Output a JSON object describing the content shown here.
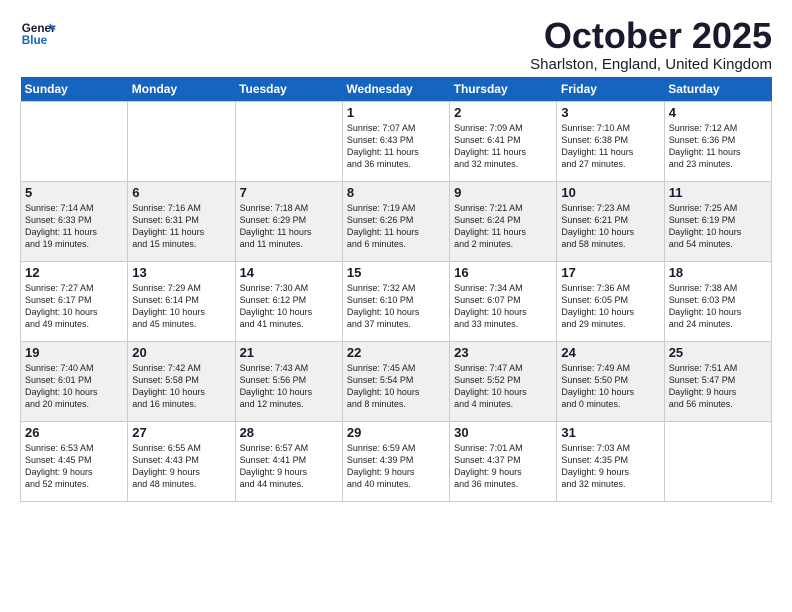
{
  "header": {
    "logo_line1": "General",
    "logo_line2": "Blue",
    "title": "October 2025",
    "subtitle": "Sharlston, England, United Kingdom"
  },
  "days": [
    "Sunday",
    "Monday",
    "Tuesday",
    "Wednesday",
    "Thursday",
    "Friday",
    "Saturday"
  ],
  "weeks": [
    [
      {
        "num": "",
        "text": ""
      },
      {
        "num": "",
        "text": ""
      },
      {
        "num": "",
        "text": ""
      },
      {
        "num": "1",
        "text": "Sunrise: 7:07 AM\nSunset: 6:43 PM\nDaylight: 11 hours\nand 36 minutes."
      },
      {
        "num": "2",
        "text": "Sunrise: 7:09 AM\nSunset: 6:41 PM\nDaylight: 11 hours\nand 32 minutes."
      },
      {
        "num": "3",
        "text": "Sunrise: 7:10 AM\nSunset: 6:38 PM\nDaylight: 11 hours\nand 27 minutes."
      },
      {
        "num": "4",
        "text": "Sunrise: 7:12 AM\nSunset: 6:36 PM\nDaylight: 11 hours\nand 23 minutes."
      }
    ],
    [
      {
        "num": "5",
        "text": "Sunrise: 7:14 AM\nSunset: 6:33 PM\nDaylight: 11 hours\nand 19 minutes."
      },
      {
        "num": "6",
        "text": "Sunrise: 7:16 AM\nSunset: 6:31 PM\nDaylight: 11 hours\nand 15 minutes."
      },
      {
        "num": "7",
        "text": "Sunrise: 7:18 AM\nSunset: 6:29 PM\nDaylight: 11 hours\nand 11 minutes."
      },
      {
        "num": "8",
        "text": "Sunrise: 7:19 AM\nSunset: 6:26 PM\nDaylight: 11 hours\nand 6 minutes."
      },
      {
        "num": "9",
        "text": "Sunrise: 7:21 AM\nSunset: 6:24 PM\nDaylight: 11 hours\nand 2 minutes."
      },
      {
        "num": "10",
        "text": "Sunrise: 7:23 AM\nSunset: 6:21 PM\nDaylight: 10 hours\nand 58 minutes."
      },
      {
        "num": "11",
        "text": "Sunrise: 7:25 AM\nSunset: 6:19 PM\nDaylight: 10 hours\nand 54 minutes."
      }
    ],
    [
      {
        "num": "12",
        "text": "Sunrise: 7:27 AM\nSunset: 6:17 PM\nDaylight: 10 hours\nand 49 minutes."
      },
      {
        "num": "13",
        "text": "Sunrise: 7:29 AM\nSunset: 6:14 PM\nDaylight: 10 hours\nand 45 minutes."
      },
      {
        "num": "14",
        "text": "Sunrise: 7:30 AM\nSunset: 6:12 PM\nDaylight: 10 hours\nand 41 minutes."
      },
      {
        "num": "15",
        "text": "Sunrise: 7:32 AM\nSunset: 6:10 PM\nDaylight: 10 hours\nand 37 minutes."
      },
      {
        "num": "16",
        "text": "Sunrise: 7:34 AM\nSunset: 6:07 PM\nDaylight: 10 hours\nand 33 minutes."
      },
      {
        "num": "17",
        "text": "Sunrise: 7:36 AM\nSunset: 6:05 PM\nDaylight: 10 hours\nand 29 minutes."
      },
      {
        "num": "18",
        "text": "Sunrise: 7:38 AM\nSunset: 6:03 PM\nDaylight: 10 hours\nand 24 minutes."
      }
    ],
    [
      {
        "num": "19",
        "text": "Sunrise: 7:40 AM\nSunset: 6:01 PM\nDaylight: 10 hours\nand 20 minutes."
      },
      {
        "num": "20",
        "text": "Sunrise: 7:42 AM\nSunset: 5:58 PM\nDaylight: 10 hours\nand 16 minutes."
      },
      {
        "num": "21",
        "text": "Sunrise: 7:43 AM\nSunset: 5:56 PM\nDaylight: 10 hours\nand 12 minutes."
      },
      {
        "num": "22",
        "text": "Sunrise: 7:45 AM\nSunset: 5:54 PM\nDaylight: 10 hours\nand 8 minutes."
      },
      {
        "num": "23",
        "text": "Sunrise: 7:47 AM\nSunset: 5:52 PM\nDaylight: 10 hours\nand 4 minutes."
      },
      {
        "num": "24",
        "text": "Sunrise: 7:49 AM\nSunset: 5:50 PM\nDaylight: 10 hours\nand 0 minutes."
      },
      {
        "num": "25",
        "text": "Sunrise: 7:51 AM\nSunset: 5:47 PM\nDaylight: 9 hours\nand 56 minutes."
      }
    ],
    [
      {
        "num": "26",
        "text": "Sunrise: 6:53 AM\nSunset: 4:45 PM\nDaylight: 9 hours\nand 52 minutes."
      },
      {
        "num": "27",
        "text": "Sunrise: 6:55 AM\nSunset: 4:43 PM\nDaylight: 9 hours\nand 48 minutes."
      },
      {
        "num": "28",
        "text": "Sunrise: 6:57 AM\nSunset: 4:41 PM\nDaylight: 9 hours\nand 44 minutes."
      },
      {
        "num": "29",
        "text": "Sunrise: 6:59 AM\nSunset: 4:39 PM\nDaylight: 9 hours\nand 40 minutes."
      },
      {
        "num": "30",
        "text": "Sunrise: 7:01 AM\nSunset: 4:37 PM\nDaylight: 9 hours\nand 36 minutes."
      },
      {
        "num": "31",
        "text": "Sunrise: 7:03 AM\nSunset: 4:35 PM\nDaylight: 9 hours\nand 32 minutes."
      },
      {
        "num": "",
        "text": ""
      }
    ]
  ]
}
